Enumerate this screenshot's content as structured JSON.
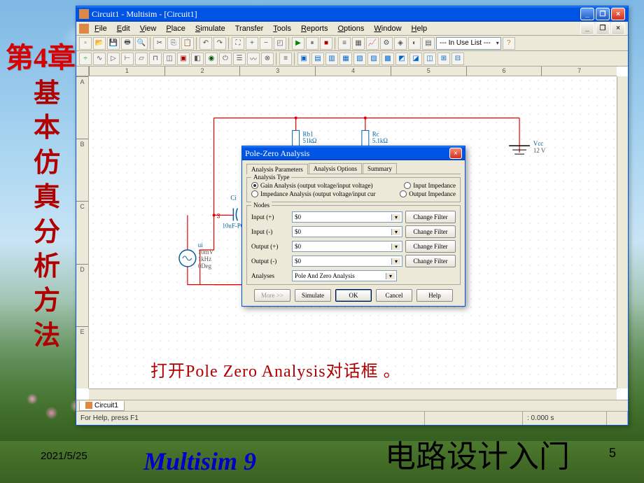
{
  "slide": {
    "chapter": "第4章",
    "subtitle": "基本仿真分析方法",
    "caption": "打开Pole Zero Analysis对话框 。",
    "date": "2021/5/25",
    "page": "5",
    "brand": "Multisim 9",
    "brand_cn": "电路设计入门"
  },
  "window": {
    "title": "Circuit1 - Multisim - [Circuit1]",
    "menu": [
      "File",
      "Edit",
      "View",
      "Place",
      "Simulate",
      "Transfer",
      "Tools",
      "Reports",
      "Options",
      "Window",
      "Help"
    ],
    "menu_accel": [
      "F",
      "E",
      "V",
      "P",
      "S",
      "",
      "T",
      "R",
      "O",
      "W",
      "H"
    ],
    "toolbar_combo": "--- In Use List ---",
    "ruler_h": [
      "1",
      "2",
      "3",
      "4",
      "5",
      "6",
      "7"
    ],
    "ruler_v": [
      "A",
      "B",
      "C",
      "D",
      "E"
    ],
    "tab": "Circuit1",
    "status_help": "For Help, press F1",
    "status_time": ": 0.000 s"
  },
  "schematic": {
    "rb1_name": "Rb1",
    "rb1_val": "51kΩ",
    "rc_name": "Rc",
    "rc_val": "5.1kΩ",
    "vcc_name": "Vcc",
    "vcc_val": "12 V",
    "ci_name": "Ci",
    "ci_val": "10uF-POL",
    "node3": "3",
    "ui_name": "ui",
    "ui_v": "10mV",
    "ui_f": "1kHz",
    "ui_d": "0Deg"
  },
  "dialog": {
    "title": "Pole-Zero Analysis",
    "tabs": [
      "Analysis Parameters",
      "Analysis Options",
      "Summary"
    ],
    "group_type": "Analysis Type",
    "radios": {
      "gain": "Gain Analysis (output voltage/input voltage)",
      "imp": "Impedance Analysis (output voltage/input cur",
      "in_imp": "Input Impedance",
      "out_imp": "Output Impedance"
    },
    "group_nodes": "Nodes",
    "node_labels": {
      "inp": "Input (+)",
      "inn": "Input (-)",
      "outp": "Output (+)",
      "outn": "Output (-)"
    },
    "node_vals": {
      "inp": "$0",
      "inn": "$0",
      "outp": "$0",
      "outn": "$0"
    },
    "change_filter": "Change Filter",
    "analyses_label": "Analyses",
    "analyses_val": "Pole And Zero Analysis",
    "buttons": {
      "more": "More >>",
      "simulate": "Simulate",
      "ok": "OK",
      "cancel": "Cancel",
      "help": "Help"
    }
  }
}
